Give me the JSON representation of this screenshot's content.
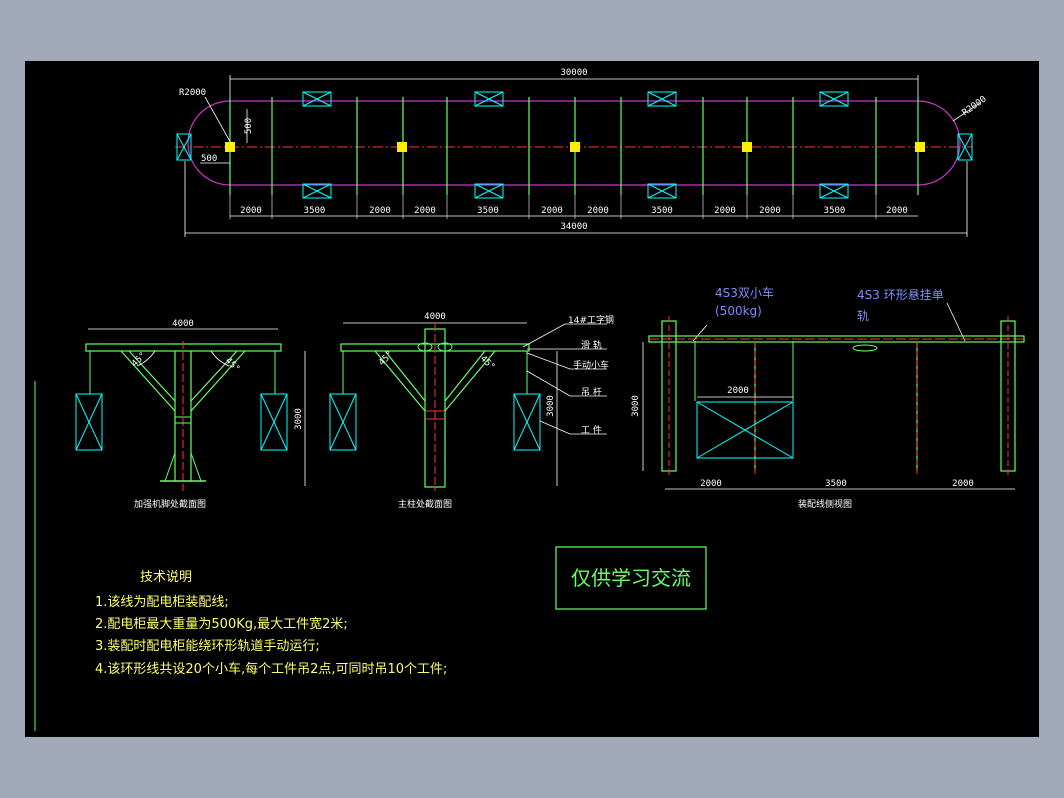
{
  "colors": {
    "frame": "#a2aab9",
    "background": "#000000",
    "rail": "#cc33cc",
    "structure": "#66ff66",
    "centerline": "#ff3333",
    "cart": "#ffee00",
    "dimension": "#ffffff",
    "box": "#00ffff",
    "callout_blue": "#7f8cff",
    "notes": "#ffff66"
  },
  "plan": {
    "overall_top": "30000",
    "overall_bottom": "34000",
    "radius_left": "R2000",
    "radius_right": "R2000",
    "dim_vertical": "500",
    "dim_horizontal": "500",
    "segments": [
      "2000",
      "3500",
      "2000",
      "2000",
      "3500",
      "2000",
      "2000",
      "3500",
      "2000",
      "2000",
      "3500",
      "2000"
    ]
  },
  "section_leg": {
    "width": "4000",
    "height": "3000",
    "angle_left": "45°",
    "angle_right": "45°",
    "caption": "加强机脚处截面图"
  },
  "section_column": {
    "width": "4000",
    "height": "3000",
    "angle_left": "45°",
    "angle_right": "45°",
    "caption": "主柱处截面图",
    "callouts": [
      "14#工字钢",
      "滑 轨",
      "手动小车",
      "吊 杆",
      "工 件"
    ]
  },
  "side_view": {
    "label_cart": "4S3双小车",
    "label_cart_weight": "(500kg)",
    "label_rail": "4S3 环形悬挂单",
    "label_rail_2": "轨",
    "workpiece_width": "2000",
    "height": "3000",
    "bottom_dims": [
      "2000",
      "3500",
      "2000"
    ],
    "caption": "装配线侧视图"
  },
  "notes": {
    "title": "技术说明",
    "items": [
      "1.该线为配电柜装配线;",
      "2.配电柜最大重量为500Kg,最大工件宽2米;",
      "3.装配时配电柜能绕环形轨道手动运行;",
      "4.该环形线共设20个小车,每个工件吊2点,可同时吊10个工件;"
    ]
  },
  "stamp": "仅供学习交流"
}
